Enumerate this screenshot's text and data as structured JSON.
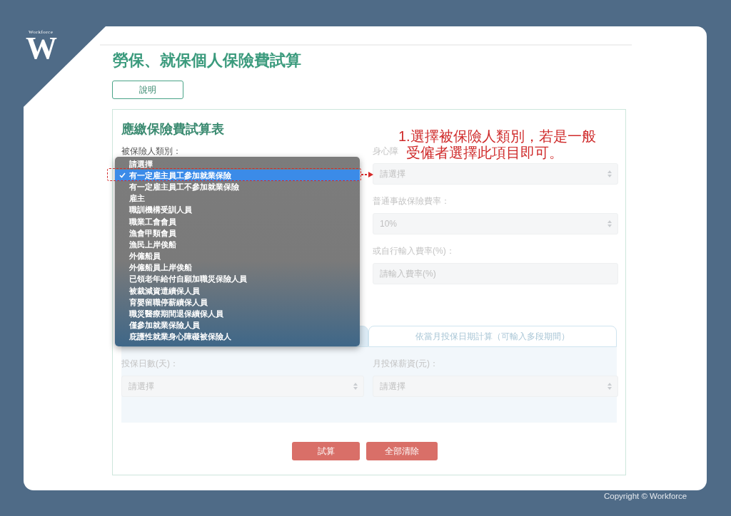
{
  "logo": {
    "letter": "W",
    "wordmark": "Workforce"
  },
  "page": {
    "title": "勞保、就保個人保險費試算",
    "help_button": "說明",
    "form": {
      "title": "應繳保險費試算表",
      "category_label": "被保險人類別：",
      "category_options": [
        {
          "label": "請選擇",
          "selected": false
        },
        {
          "label": "有一定雇主員工參加就業保險",
          "selected": true
        },
        {
          "label": "有一定雇主員工不參加就業保險",
          "selected": false
        },
        {
          "label": "雇主",
          "selected": false
        },
        {
          "label": "職訓機構受訓人員",
          "selected": false
        },
        {
          "label": "職業工會會員",
          "selected": false
        },
        {
          "label": "漁會甲類會員",
          "selected": false
        },
        {
          "label": "漁民上岸俟船",
          "selected": false
        },
        {
          "label": "外僱船員",
          "selected": false
        },
        {
          "label": "外僱船員上岸俟船",
          "selected": false
        },
        {
          "label": "已領老年給付自願加職災保險人員",
          "selected": false
        },
        {
          "label": "被裁減資遣續保人員",
          "selected": false
        },
        {
          "label": "育嬰留職停薪續保人員",
          "selected": false
        },
        {
          "label": "職災醫療期間退保續保人員",
          "selected": false
        },
        {
          "label": "僅參加就業保險人員",
          "selected": false
        },
        {
          "label": "庇護性就業身心障礙被保險人",
          "selected": false
        }
      ],
      "right_fields": [
        {
          "kind": "select",
          "label": "身心障",
          "value": "請選擇"
        },
        {
          "kind": "select",
          "label": "普通事故保險費率：",
          "value": "10%"
        },
        {
          "kind": "input",
          "label": "或自行輸入費率(%)：",
          "placeholder": "請輸入費率(%)"
        }
      ],
      "tabs": [
        {
          "selected": true
        },
        {
          "label": "依當月投保日期計算（可輸入多段期間）",
          "selected": false
        }
      ],
      "period_fields": [
        {
          "kind": "select",
          "label": "投保日數(天)：",
          "value": "請選擇"
        },
        {
          "kind": "select",
          "label": "月投保薪資(元)：",
          "value": "請選擇"
        }
      ],
      "buttons": [
        "試算",
        "全部清除"
      ]
    }
  },
  "annotation": {
    "lines": [
      "1.選擇被保險人類別，若是一般",
      "受僱者選擇此項目即可。"
    ]
  },
  "copyright": "Copyright © Workforce"
}
